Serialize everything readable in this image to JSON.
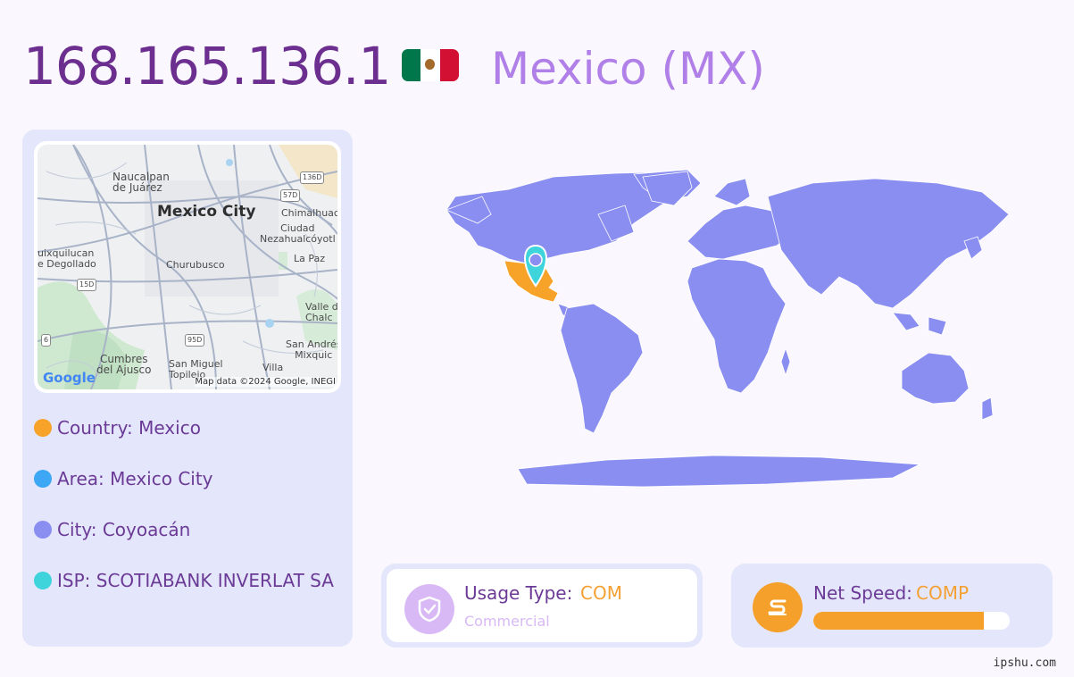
{
  "header": {
    "ip": "168.165.136.1",
    "country_title": "Mexico (MX)"
  },
  "map": {
    "labels": {
      "naucalpan": "Naucalpan\nde Juárez",
      "mexico_city": "Mexico City",
      "chimalhuacan": "Chimalhuac",
      "ciudad": "Ciudad\nNezahualcóyotl",
      "huixquilucan": "uixquilucan\ne Degollado",
      "churubusco": "Churubusco",
      "la_paz": "La Paz",
      "valle": "Valle d\nChalc",
      "cumbres": "Cumbres\ndel Ajusco",
      "san_miguel": "San Miguel\nTopilejo",
      "villa": "Villa",
      "san_andres": "San Andrés\nMixquic",
      "shield_136d": "136D",
      "shield_57d": "57D",
      "shield_15d": "15D",
      "shield_95d": "95D",
      "shield_6": "6"
    },
    "google_logo": "Google",
    "attribution": "Map data ©2024 Google, INEGI"
  },
  "info": [
    {
      "label": "Country: Mexico",
      "color": "#f7a229"
    },
    {
      "label": "Area: Mexico City",
      "color": "#3da7f5"
    },
    {
      "label": "City: Coyoacán",
      "color": "#8a8ef0"
    },
    {
      "label": "ISP: SCOTIABANK INVERLAT SA",
      "color": "#3fd3dc"
    }
  ],
  "usage": {
    "label": "Usage Type:",
    "value": "COM",
    "sub": "Commercial",
    "icon": "shield-check-icon"
  },
  "speed": {
    "label": "Net Speed:",
    "value": "COMP",
    "icon": "speed-s-icon",
    "level_percent": 87
  },
  "watermark": "ipshu.com",
  "colors": {
    "land": "#8a8ef0",
    "highlight": "#f7a229",
    "pin": "#3fd3dc"
  }
}
